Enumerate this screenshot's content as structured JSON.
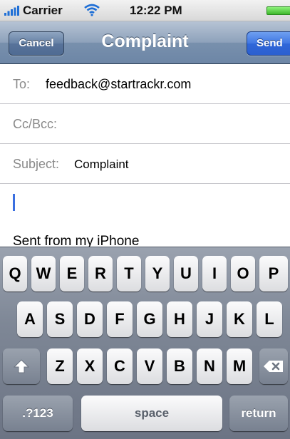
{
  "status_bar": {
    "carrier": "Carrier",
    "time": "12:22 PM",
    "battery_color": "#4fd13a"
  },
  "nav": {
    "cancel_label": "Cancel",
    "title": "Complaint",
    "send_label": "Send"
  },
  "fields": {
    "to_label": "To:",
    "to_value": "feedback@startrackr.com",
    "cc_label": "Cc/Bcc:",
    "subject_label": "Subject:",
    "subject_value": "Complaint"
  },
  "body": {
    "signature": "Sent from my iPhone"
  },
  "keyboard": {
    "row1": [
      "Q",
      "W",
      "E",
      "R",
      "T",
      "Y",
      "U",
      "I",
      "O",
      "P"
    ],
    "row2": [
      "A",
      "S",
      "D",
      "F",
      "G",
      "H",
      "J",
      "K",
      "L"
    ],
    "row3": [
      "Z",
      "X",
      "C",
      "V",
      "B",
      "N",
      "M"
    ],
    "numbers_label": ".?123",
    "space_label": "space",
    "return_label": "return",
    "shift_icon": "shift-arrow",
    "delete_icon": "backspace"
  }
}
